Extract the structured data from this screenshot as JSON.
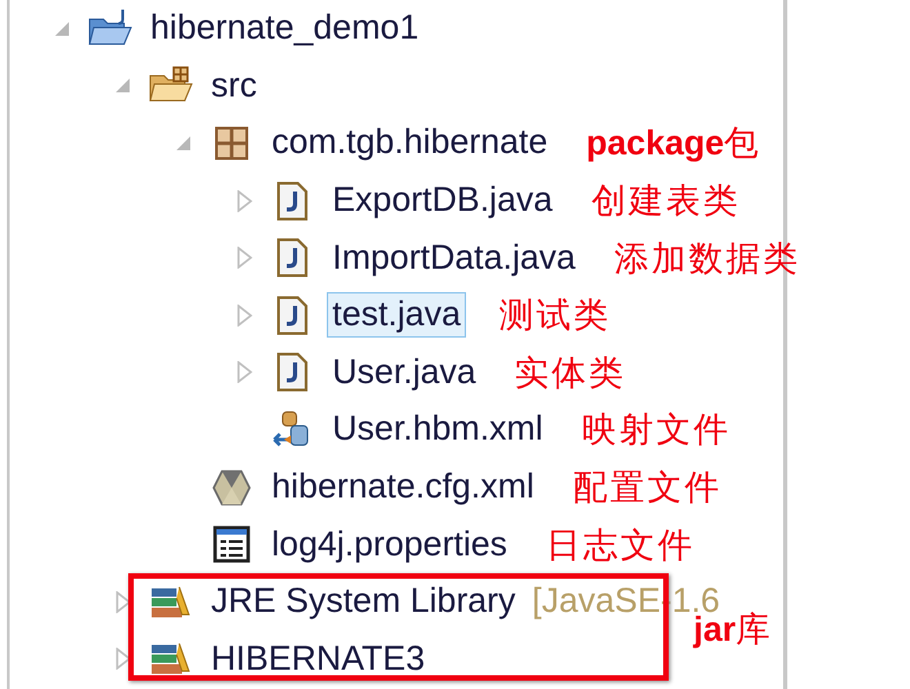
{
  "tree": [
    {
      "label": "hibernate_demo1",
      "kind": "project",
      "expanded": true,
      "selected": false,
      "children": [
        {
          "label": "src",
          "kind": "source-folder",
          "expanded": true,
          "selected": false,
          "children": [
            {
              "label": "com.tgb.hibernate",
              "kind": "package",
              "expanded": true,
              "selected": false,
              "annotation": "**package**包",
              "children": [
                {
                  "label": "ExportDB.java",
                  "kind": "java",
                  "expanded": false,
                  "selected": false,
                  "annotation": "创建表类"
                },
                {
                  "label": "ImportData.java",
                  "kind": "java",
                  "expanded": false,
                  "selected": false,
                  "annotation": "添加数据类"
                },
                {
                  "label": "test.java",
                  "kind": "java",
                  "expanded": false,
                  "selected": true,
                  "annotation": "测试类"
                },
                {
                  "label": "User.java",
                  "kind": "java",
                  "expanded": false,
                  "selected": false,
                  "annotation": "实体类"
                },
                {
                  "label": "User.hbm.xml",
                  "kind": "mapping",
                  "selected": false,
                  "annotation": "映射文件"
                }
              ]
            },
            {
              "label": "hibernate.cfg.xml",
              "kind": "config",
              "selected": false,
              "annotation": "配置文件"
            },
            {
              "label": "log4j.properties",
              "kind": "properties",
              "selected": false,
              "annotation": "日志文件"
            }
          ]
        },
        {
          "label": "JRE System Library",
          "kind": "library",
          "expanded": false,
          "selected": false,
          "decoration": "[JavaSE-1.6"
        },
        {
          "label": "HIBERNATE3",
          "kind": "library",
          "expanded": false,
          "selected": false
        }
      ]
    }
  ],
  "callout": {
    "label": "**jar**库"
  }
}
